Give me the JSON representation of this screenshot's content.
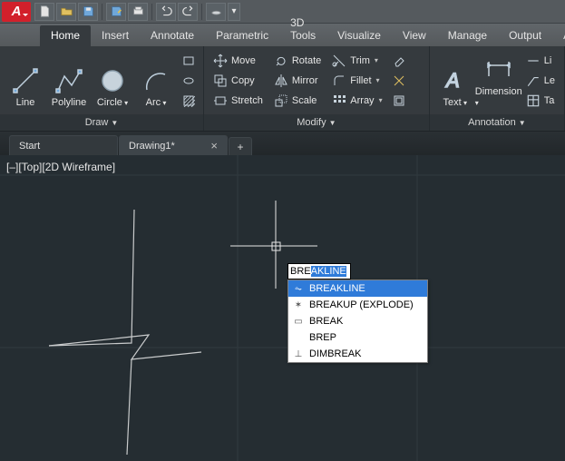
{
  "ribbon": {
    "tabs": [
      "Home",
      "Insert",
      "Annotate",
      "Parametric",
      "3D Tools",
      "Visualize",
      "View",
      "Manage",
      "Output",
      "Add"
    ],
    "active_tab": 0,
    "panels": {
      "draw": {
        "label": "Draw",
        "line": "Line",
        "polyline": "Polyline",
        "circle": "Circle",
        "arc": "Arc"
      },
      "modify": {
        "label": "Modify",
        "move": "Move",
        "copy": "Copy",
        "stretch": "Stretch",
        "rotate": "Rotate",
        "mirror": "Mirror",
        "scale": "Scale",
        "trim": "Trim",
        "fillet": "Fillet",
        "array": "Array"
      },
      "annotation": {
        "label": "Annotation",
        "text": "Text",
        "dimension": "Dimension",
        "linear": "Li",
        "leader": "Le",
        "table": "Ta"
      }
    }
  },
  "doc_tabs": {
    "start": "Start",
    "drawing": "Drawing1*"
  },
  "viewport_label": "[–][Top][2D Wireframe]",
  "command": {
    "typed": "BRE",
    "suggest": "AKLINE"
  },
  "autocomplete": {
    "items": [
      {
        "icon": "breakline",
        "label": "BREAKLINE"
      },
      {
        "icon": "explode",
        "label": "BREAKUP (EXPLODE)"
      },
      {
        "icon": "break",
        "label": "BREAK"
      },
      {
        "icon": "",
        "label": "BREP"
      },
      {
        "icon": "dim",
        "label": "DIMBREAK"
      }
    ],
    "selected": 0
  }
}
